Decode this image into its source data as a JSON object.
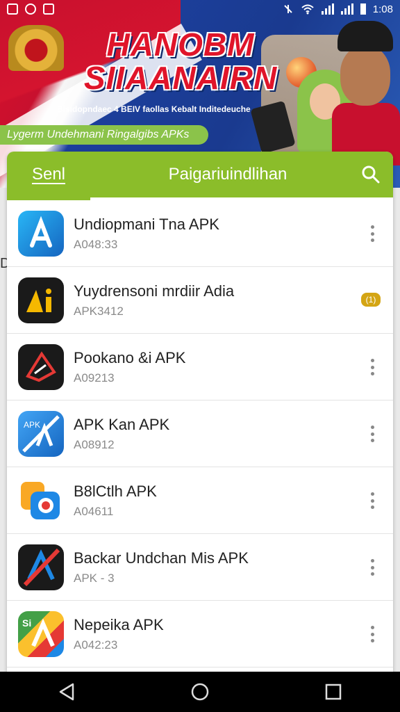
{
  "status_bar": {
    "time": "1:08"
  },
  "banner": {
    "title_line1": "HANOBM",
    "title_line2": "SIIAANAIRN",
    "subtitle": "Bisidopndaec 4 BEIV faollas Kebalt Inditedeuche",
    "ribbon": "Lygerm Undehmani Ringalgibs APKs"
  },
  "header": {
    "tab_label": "Senl",
    "title": "Paigariuindlihan",
    "accent_color": "#8bbd2a"
  },
  "apps": [
    {
      "name": "Undiopmani Tna APK",
      "sub": "A048:33",
      "icon": "app-store-icon",
      "menu": "more"
    },
    {
      "name": "Yuydrensoni mrdiir Adia",
      "sub": "APK3412",
      "icon": "ai-icon",
      "menu": "badge",
      "badge": "(1)"
    },
    {
      "name": "Pookano &i APK",
      "sub": "A09213",
      "icon": "arrow-logo-icon",
      "menu": "more"
    },
    {
      "name": "APK Kan APK",
      "sub": "A08912",
      "icon": "apk-blue-icon",
      "menu": "more"
    },
    {
      "name": "B8lCtlh APK",
      "sub": "A04611",
      "icon": "b-camera-icon",
      "menu": "more"
    },
    {
      "name": "Backar Undchan Mis APK",
      "sub": "APK - 3",
      "icon": "a-slash-icon",
      "menu": "more"
    },
    {
      "name": "Nepeika APK",
      "sub": "A042:23",
      "icon": "si-multicolor-icon",
      "menu": "more"
    }
  ],
  "edge_char": "D",
  "nav": {
    "back": "back",
    "home": "home",
    "recents": "recents"
  }
}
